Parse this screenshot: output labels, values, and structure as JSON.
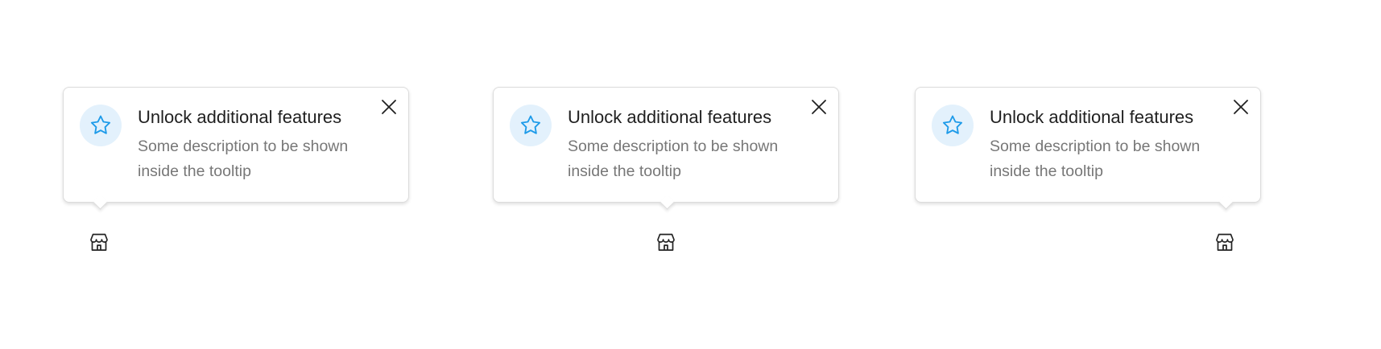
{
  "colors": {
    "accent": "#1e9be9",
    "badge_background": "#e3f1fc",
    "title_text": "#1f1f1f",
    "description_text": "#777777",
    "border": "#dcdcdc"
  },
  "tooltips": [
    {
      "placement": "bottom-start",
      "icon": "star-icon",
      "title": "Unlock additional features",
      "description": "Some description to be shown inside the tooltip",
      "close_icon": "close-icon",
      "anchor_icon": "store-icon"
    },
    {
      "placement": "bottom-center",
      "icon": "star-icon",
      "title": "Unlock additional features",
      "description": "Some description to be shown inside the tooltip",
      "close_icon": "close-icon",
      "anchor_icon": "store-icon"
    },
    {
      "placement": "bottom-end",
      "icon": "star-icon",
      "title": "Unlock additional features",
      "description": "Some description to be shown inside the tooltip",
      "close_icon": "close-icon",
      "anchor_icon": "store-icon"
    }
  ]
}
